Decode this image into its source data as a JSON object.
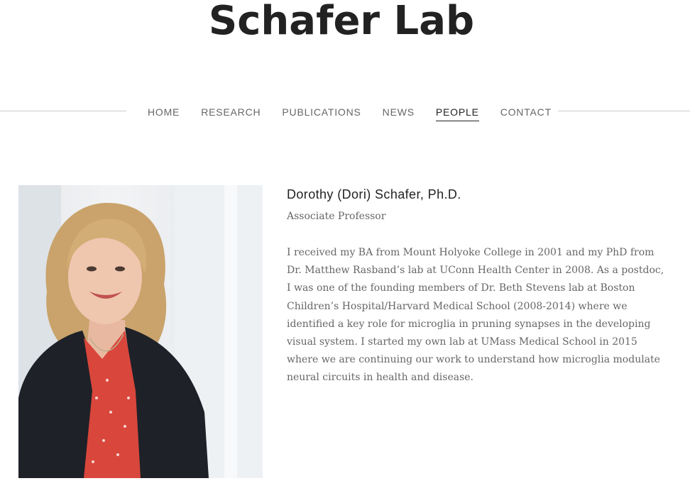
{
  "site": {
    "title": "Schafer Lab"
  },
  "nav": {
    "items": [
      {
        "label": "HOME"
      },
      {
        "label": "RESEARCH"
      },
      {
        "label": "PUBLICATIONS"
      },
      {
        "label": "NEWS"
      },
      {
        "label": "PEOPLE",
        "active": true
      },
      {
        "label": "CONTACT"
      }
    ]
  },
  "person": {
    "name": "Dorothy (Dori) Schafer, Ph.D.",
    "role": "Associate Professor",
    "bio": "I received my BA from Mount Holyoke College in 2001 and my PhD from Dr. Matthew Rasband’s lab at UConn Health Center in 2008. As a postdoc, I was one of the founding members of Dr. Beth Stevens lab at Boston Children’s Hospital/Harvard Medical School (2008-2014) where we identified a key role for microglia in pruning synapses in the developing visual system. I started my own lab at UMass Medical School in 2015 where we are continuing our work to understand how microglia modulate neural circuits in health and disease."
  },
  "colors": {
    "text_dark": "#222222",
    "text_muted": "#666666",
    "rule": "#cccccc",
    "blazer": "#1e2128",
    "blouse": "#d9463c",
    "hair": "#c9a36b"
  }
}
